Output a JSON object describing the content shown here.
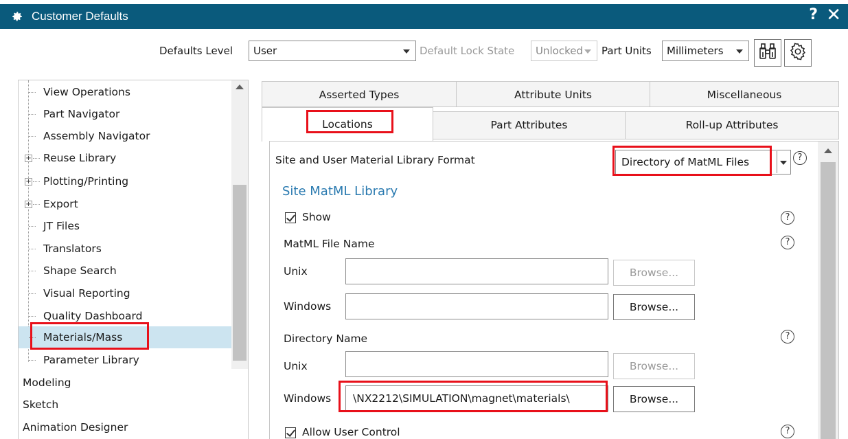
{
  "window": {
    "title": "Customer Defaults",
    "help_glyph": "?",
    "close_glyph": "✕"
  },
  "toolbar": {
    "defaults_level_label": "Defaults Level",
    "defaults_level_value": "User",
    "lock_state_label": "Default Lock State",
    "lock_state_value": "Unlocked",
    "part_units_label": "Part Units",
    "part_units_value": "Millimeters",
    "find_icon": "binoculars-icon",
    "settings_icon": "gear-icon"
  },
  "tree": {
    "items": [
      {
        "label": "View Operations"
      },
      {
        "label": "Part Navigator"
      },
      {
        "label": "Assembly Navigator"
      },
      {
        "label": "Reuse Library",
        "expander": "+"
      },
      {
        "label": "Plotting/Printing",
        "expander": "+"
      },
      {
        "label": "Export",
        "expander": "+"
      },
      {
        "label": "JT Files"
      },
      {
        "label": "Translators"
      },
      {
        "label": "Shape Search"
      },
      {
        "label": "Visual Reporting"
      },
      {
        "label": "Quality Dashboard"
      },
      {
        "label": "Materials/Mass",
        "selected": true
      },
      {
        "label": "Parameter Library"
      },
      {
        "label": "Modeling"
      },
      {
        "label": "Sketch"
      },
      {
        "label": "Animation Designer"
      }
    ]
  },
  "tabs": {
    "row1": [
      "Asserted Types",
      "Attribute Units",
      "Miscellaneous"
    ],
    "row2": [
      "Locations",
      "Part Attributes",
      "Roll-up Attributes"
    ],
    "active": "Locations"
  },
  "content": {
    "format_label": "Site and User Material Library Format",
    "format_value": "Directory of MatML Files",
    "site_section": "Site MatML Library",
    "show_label": "Show",
    "matml_file_name_label": "MatML File Name",
    "unix_label": "Unix",
    "windows_label": "Windows",
    "browse_label": "Browse...",
    "directory_name_label": "Directory Name",
    "dir_windows_value": "\\NX2212\\SIMULATION\\magnet\\materials\\",
    "allow_user_control_label": "Allow User Control",
    "help_glyph": "?"
  }
}
